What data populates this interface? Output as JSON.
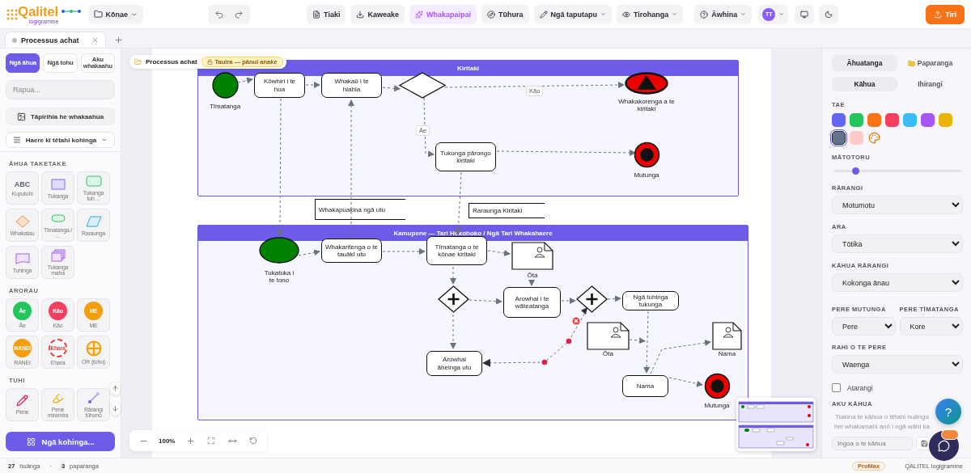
{
  "toolbar": {
    "logo": "Qalitel",
    "logo_sub": "logigramme",
    "file_menu": "Kōnae",
    "buttons": [
      {
        "kind": "save",
        "label": "Tiaki",
        "menu": false
      },
      {
        "kind": "export",
        "label": "Kaweake",
        "menu": false
      },
      {
        "kind": "beautify",
        "label": "Whakapaipai",
        "menu": false
      },
      {
        "kind": "explore",
        "label": "Tūhura",
        "menu": false
      },
      {
        "kind": "tools",
        "label": "Ngā taputapu",
        "menu": true
      },
      {
        "kind": "view",
        "label": "Tirohanga",
        "menu": true
      }
    ],
    "help": "Āwhina",
    "avatar": "TT",
    "share": "Tiri"
  },
  "doc_tabs": [
    {
      "label": "Processus achat",
      "selected": true
    }
  ],
  "left": {
    "tabs": [
      {
        "label": "Ngā āhua",
        "selected": true
      },
      {
        "label": "Ngā tohu",
        "selected": false
      },
      {
        "label": "Aku whakaahu",
        "selected": false
      }
    ],
    "search": {
      "placeholder": "Rapua..."
    },
    "add_image": "Tāpirihia he whakaahua",
    "collection_select": "Haere ki tētahi kohinga",
    "sections": [
      {
        "title": "ĀHUA TAKETAKE",
        "items": [
          {
            "kind": "text",
            "glyph": "ABC",
            "label": "Kuputuhi"
          },
          {
            "kind": "rect",
            "label": "Tukanga"
          },
          {
            "kind": "rounded",
            "label": "Tukanga tuh…"
          },
          {
            "kind": "diamond",
            "label": "Whakatau"
          },
          {
            "kind": "pill",
            "label": "Tīmatanga / …"
          },
          {
            "kind": "parallelogram",
            "label": "Raraunga"
          },
          {
            "kind": "doc",
            "label": "Tuhinga"
          },
          {
            "kind": "multi",
            "label": "Tukanga maha"
          }
        ]
      },
      {
        "title": "ARORAU",
        "items": [
          {
            "kind": "badge",
            "color": "#22c55e",
            "glyph": "Āe",
            "label": "Āe"
          },
          {
            "kind": "badge",
            "color": "#f43f5e",
            "glyph": "Kāo",
            "label": "Kāo"
          },
          {
            "kind": "badge",
            "color": "#f59e0b",
            "glyph": "ME",
            "label": "ME"
          },
          {
            "kind": "badge",
            "color": "#f59e0b",
            "glyph": "RANEI",
            "label": "RANEI"
          },
          {
            "kind": "dashed",
            "color": "#ef4444",
            "glyph": "Ehara",
            "label": "Ehara"
          },
          {
            "kind": "cross",
            "color": "#f59e0b",
            "label": "OR (tohu)"
          }
        ]
      },
      {
        "title": "TUHI",
        "items": [
          {
            "kind": "pen",
            "label": "Pene"
          },
          {
            "kind": "highlighter",
            "label": "Pene miramira"
          },
          {
            "kind": "connector",
            "label": "Rārangi tūhono"
          }
        ]
      }
    ],
    "collections_button": "Ngā kohinga..."
  },
  "canvas": {
    "breadcrumb": "Processus achat",
    "badge": "Tauira — pānui anake",
    "pools": [
      {
        "title": "Kiritaki"
      },
      {
        "title": "Kamupene — Tari Hokohoko / Ngā Tari Whakahaere"
      }
    ],
    "annotations": [
      "Whakapuakina ngā utu",
      "Raraunga Kiritaki"
    ],
    "nodes": [
      {
        "kind": "start",
        "label": "Tīmatanga"
      },
      {
        "kind": "task",
        "label": "Kōwhiri i te hua"
      },
      {
        "kind": "task",
        "label": "Whakaū i te hiahia"
      },
      {
        "kind": "gateway"
      },
      {
        "kind": "end_cancel",
        "label": "Whakakorenga a te kiritaki"
      },
      {
        "kind": "task",
        "label": "Tukunga pārongo kiritaki"
      },
      {
        "kind": "end",
        "label": "Mutunga"
      },
      {
        "kind": "start",
        "label": "Tukatuka i te tono"
      },
      {
        "kind": "task",
        "label": "Whakaritenga o te tauākī utu"
      },
      {
        "kind": "task",
        "label": "Tīmatanga o te kōnae kiritaki"
      },
      {
        "kind": "document",
        "label": "Ōta"
      },
      {
        "kind": "gateway_parallel"
      },
      {
        "kind": "task",
        "label": "Arowhai i te wāteatanga"
      },
      {
        "kind": "gateway_parallel"
      },
      {
        "kind": "task",
        "label": "Ngā tuhinga tukunga"
      },
      {
        "kind": "document",
        "label": "Ōta"
      },
      {
        "kind": "document",
        "label": "Nama"
      },
      {
        "kind": "task",
        "label": "Arowhai āheinga utu"
      },
      {
        "kind": "task",
        "label": "Nama"
      },
      {
        "kind": "end",
        "label": "Mutunga"
      }
    ],
    "edge_labels": [
      "Kāo",
      "Āe"
    ],
    "zoom": "100%"
  },
  "right": {
    "tabs": [
      {
        "label": "Āhuatanga",
        "selected": true
      },
      {
        "label": "Paparanga",
        "selected": false
      }
    ],
    "subtabs": [
      {
        "label": "Kāhua",
        "selected": true
      },
      {
        "label": "Ihirangi",
        "selected": false
      }
    ],
    "color_label": "TAE",
    "colors": [
      {
        "color": "#6366f1",
        "selected": false
      },
      {
        "color": "#22c55e",
        "selected": false
      },
      {
        "color": "#f97316",
        "selected": false
      },
      {
        "color": "#f43f5e",
        "selected": false
      },
      {
        "color": "#38bdf8",
        "selected": false
      },
      {
        "color": "#a855f7",
        "selected": false
      },
      {
        "color": "#eab308",
        "selected": false
      },
      {
        "color": "#64748b",
        "selected": true
      },
      {
        "color": "#fecaca",
        "selected": false
      }
    ],
    "thickness": {
      "label": "MĀTOTORU",
      "level": 0.17
    },
    "fields": [
      {
        "label": "RĀRANGI",
        "value": "Motumotu"
      },
      {
        "label": "ARA",
        "value": "Tōtika"
      },
      {
        "label": "KĀHUA RĀRANGI",
        "value": "Kokonga ānau"
      }
    ],
    "arrows": [
      {
        "label": "PERE MUTUNGA",
        "value": "Pere"
      },
      {
        "label": "PERE TĪMATANGA",
        "value": "Kore"
      }
    ],
    "arrow_size": {
      "label": "RAHI O TE PERE",
      "value": "Waenga"
    },
    "shadow": {
      "label": "Atarangi",
      "checked": false
    },
    "my_styles": {
      "title": "AKU KĀHUA",
      "hint": "Tiakina te kāhua o tētahi huānga hei whakamahi anō i ngā wāhi ka",
      "placeholder": "Ingoa o te kāhua"
    }
  },
  "help_button": "?",
  "status": {
    "count": "27",
    "count_label": "huānga",
    "separator": "·",
    "layers": "3",
    "layers_label": "paparanga",
    "plan": "ProMax",
    "brand": "QALITEL logigramme"
  }
}
